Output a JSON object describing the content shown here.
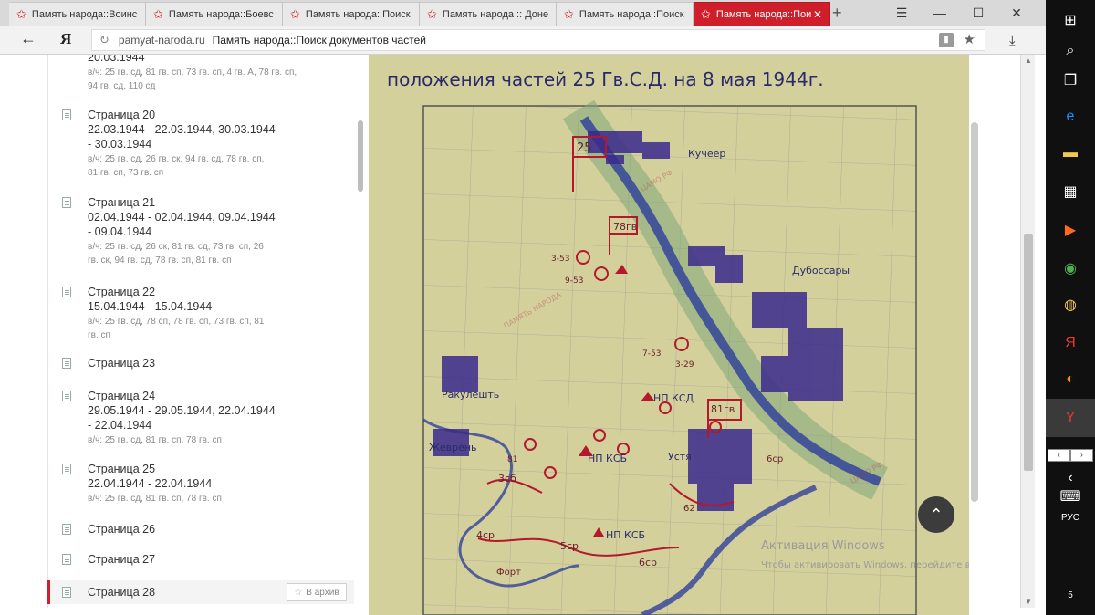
{
  "browser": {
    "tabs": [
      {
        "label": "Память народа::Воинс",
        "active": false
      },
      {
        "label": "Память народа::Боевс",
        "active": false
      },
      {
        "label": "Память народа::Поиск",
        "active": false
      },
      {
        "label": "Память народа :: Доне",
        "active": false
      },
      {
        "label": "Память народа::Поиск",
        "active": false
      },
      {
        "label": "Память народа::Пои",
        "active": true
      }
    ],
    "new_tab": "+",
    "window_controls": [
      "☰",
      "—",
      "☐",
      "✕"
    ],
    "address": {
      "host": "pamyat-naroda.ru",
      "title": "Память народа::Поиск документов частей"
    },
    "yandex_logo": "Я",
    "back": "←",
    "download": "⤓"
  },
  "pages_list": {
    "top_truncated_date": "20.03.1944",
    "top_truncated_units": "в/ч: 25 гв. сд, 81 гв. сп, 73 гв. сп, 4 гв. А, 78 гв. сп, 94 гв. сд, 110 сд",
    "items": [
      {
        "name": "Страница 20",
        "dates": "22.03.1944 - 22.03.1944, 30.03.1944 - 30.03.1944",
        "units": "в/ч: 25 гв. сд, 26 гв. ск, 94 гв. сд, 78 гв. сп, 81 гв. сп, 73 гв. сп"
      },
      {
        "name": "Страница 21",
        "dates": "02.04.1944 - 02.04.1944, 09.04.1944 - 09.04.1944",
        "units": "в/ч: 25 гв. сд, 26 ск, 81 гв. сд, 73 гв. сп, 26 гв. ск, 94 гв. сд, 78 гв. сп, 81 гв. сп"
      },
      {
        "name": "Страница 22",
        "dates": "15.04.1944 - 15.04.1944",
        "units": "в/ч: 25 гв. сд, 78 сп, 78 гв. сп, 73 гв. сп, 81 гв. сп"
      },
      {
        "name": "Страница 23",
        "dates": "",
        "units": ""
      },
      {
        "name": "Страница 24",
        "dates": "29.05.1944 - 29.05.1944, 22.04.1944 - 22.04.1944",
        "units": "в/ч: 25 гв. сд, 81 гв. сп, 78 гв. сп"
      },
      {
        "name": "Страница 25",
        "dates": "22.04.1944 - 22.04.1944",
        "units": "в/ч: 25 гв. сд, 81 гв. сп, 78 гв. сп"
      },
      {
        "name": "Страница 26",
        "dates": "",
        "units": ""
      },
      {
        "name": "Страница 27",
        "dates": "",
        "units": ""
      },
      {
        "name": "Страница 28",
        "dates": "",
        "units": ""
      }
    ],
    "archive_button": "В архив"
  },
  "map": {
    "title": "положения частей 25 Гв.С.Д. на 8 мая 1944г.",
    "labels": {
      "kucheer": "Кучеер",
      "dubossary": "Дубоссары",
      "rakuleshty": "Ракулешть",
      "zhevren": "Жеврень",
      "ustya": "Устя",
      "np_ksd": "НП КСД",
      "np_ksb1": "НП КСБ",
      "np_ksb2": "НП КСБ",
      "flag25": "25",
      "flag78": "78гв",
      "flag81": "81гв",
      "u353": "3-53",
      "u953": "9-53",
      "u753": "7-53",
      "u329": "3-29",
      "b3sb": "3сб",
      "b4sr": "4ср",
      "b5sr": "5ср",
      "b6sr": "6ср",
      "b6sr2": "6ср",
      "b62": "62",
      "r81": "81",
      "fort": "Форт"
    },
    "watermark": "ЦАМО РФ",
    "watermark_brand": "ПАМЯТЬ НАРОДА",
    "win_activation": "Активация Windows",
    "win_activation_sub": "Чтобы активировать Windows, перейдите в раздел «Параметры»."
  },
  "scroll_top_button": "⌃",
  "taskbar": {
    "language": "РУС",
    "notification": "5"
  },
  "colors": {
    "accent": "#cf1f2b",
    "map_bg": "#d6d2a0",
    "map_blue": "#3a2a8c",
    "map_red": "#b3182c"
  }
}
